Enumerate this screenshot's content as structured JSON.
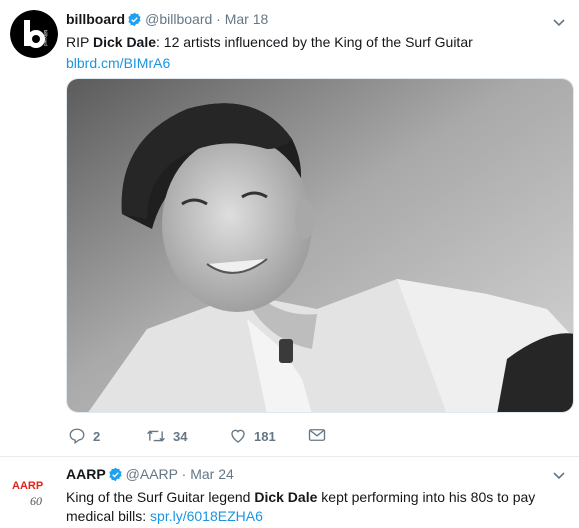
{
  "tweets": [
    {
      "display_name": "billboard",
      "handle": "@billboard",
      "separator": "·",
      "date": "Mar 18",
      "avatar_text": "billboard",
      "text_prefix": "RIP ",
      "text_bold": "Dick Dale",
      "text_suffix": ": 12 artists influenced by the King of the Surf Guitar",
      "link": "blbrd.cm/BIMrA6",
      "replies": "2",
      "retweets": "34",
      "likes": "181"
    },
    {
      "display_name": "AARP",
      "handle": "@AARP",
      "separator": "·",
      "date": "Mar 24",
      "avatar_text": "AARP",
      "avatar_badge": "60",
      "text_prefix": "King of the Surf Guitar legend ",
      "text_bold": "Dick Dale",
      "text_suffix": " kept performing into his 80s to pay medical bills: ",
      "link": "spr.ly/6018EZHA6"
    }
  ],
  "icons": {
    "verified": "verified-badge-icon",
    "caret": "chevron-down-icon",
    "reply": "reply-icon",
    "retweet": "retweet-icon",
    "like": "heart-icon",
    "dm": "envelope-icon"
  },
  "colors": {
    "link": "#1b95e0",
    "verified": "#1da1f2",
    "muted": "#657786",
    "text": "#14171a",
    "aarp_red": "#e2231a"
  }
}
